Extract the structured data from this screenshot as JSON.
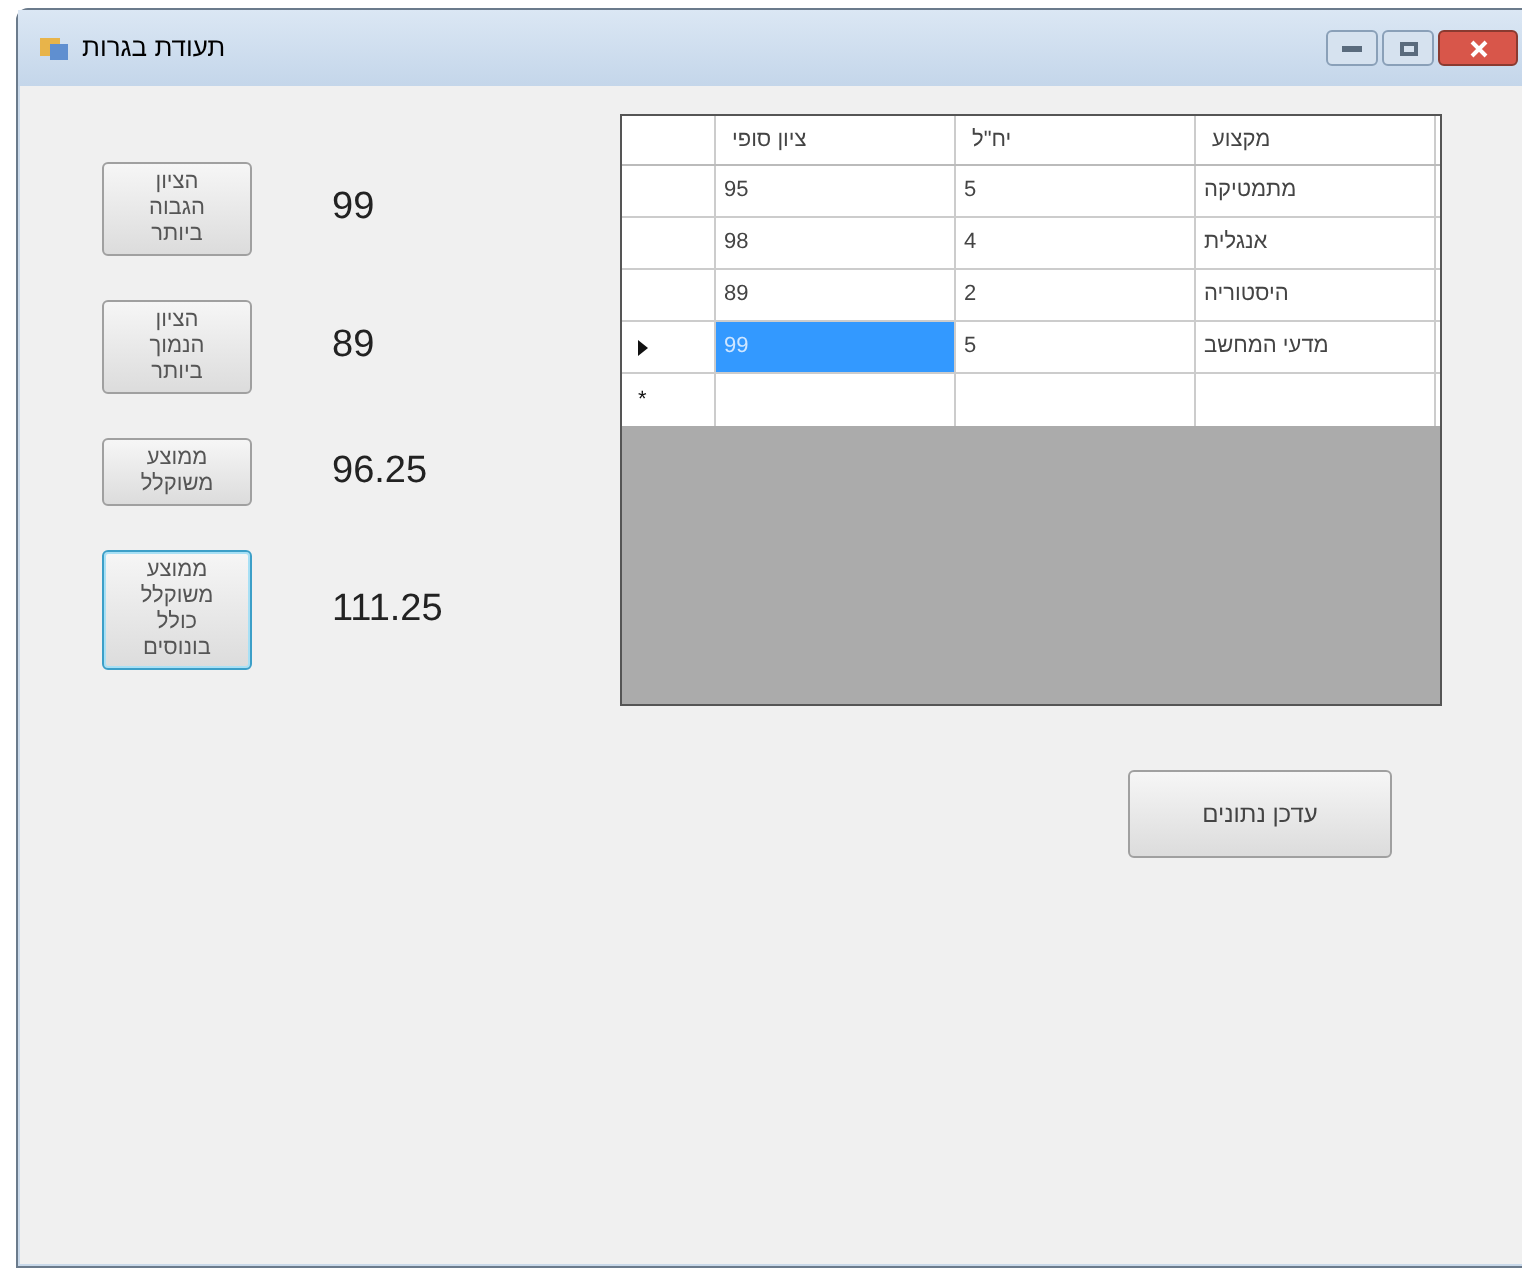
{
  "window": {
    "title": "תעודת בגרות"
  },
  "stats": [
    {
      "button": "הציון הגבוה ביותר",
      "value": "99",
      "focused": false
    },
    {
      "button": "הציון הנמוך ביותר",
      "value": "89",
      "focused": false
    },
    {
      "button": "ממוצע משוקלל",
      "value": "96.25",
      "focused": false
    },
    {
      "button": "ממוצע משוקלל כולל בונוסים",
      "value": "111.25",
      "focused": true
    }
  ],
  "table": {
    "columns": [
      "מקצוע",
      "יח\"ל",
      "ציון סופי"
    ],
    "rows": [
      {
        "cells": [
          "מתמטיקה",
          "5",
          "95"
        ],
        "selected": false
      },
      {
        "cells": [
          "אנגלית",
          "4",
          "98"
        ],
        "selected": false
      },
      {
        "cells": [
          "היסטוריה",
          "2",
          "89"
        ],
        "selected": false
      },
      {
        "cells": [
          "מדעי המחשב",
          "5",
          "99"
        ],
        "selected": true
      }
    ],
    "new_row_marker": "*"
  },
  "update_button": "עדכן נתונים"
}
